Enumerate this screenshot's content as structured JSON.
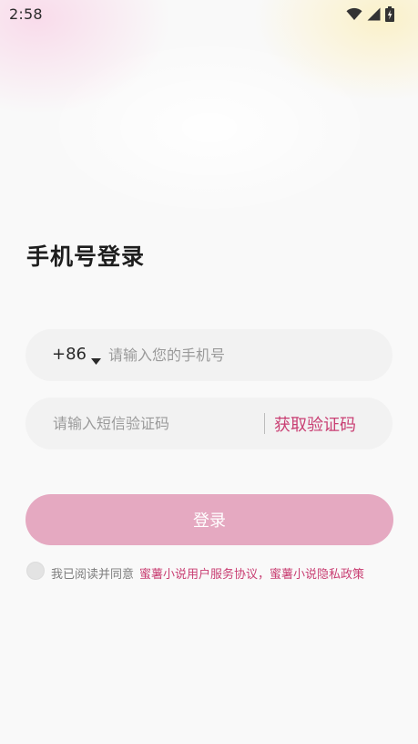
{
  "status_bar": {
    "time": "2:58",
    "icons": [
      "wifi-icon",
      "signal-icon",
      "battery-charging-icon"
    ]
  },
  "page": {
    "title": "手机号登录"
  },
  "phone_field": {
    "country_code": "+86",
    "placeholder": "请输入您的手机号",
    "value": ""
  },
  "code_field": {
    "placeholder": "请输入短信验证码",
    "value": "",
    "get_code_label": "获取验证码"
  },
  "login": {
    "label": "登录"
  },
  "agreement": {
    "prefix": "我已阅读并同意",
    "user_agreement": "蜜薯小说用户服务协议，",
    "privacy_policy": "蜜薯小说隐私政策",
    "checked": false
  },
  "colors": {
    "accent": "#c93f73",
    "login_button": "#e5a9c1",
    "field_background": "#f2f2f2",
    "page_background": "#f9f9f9"
  }
}
